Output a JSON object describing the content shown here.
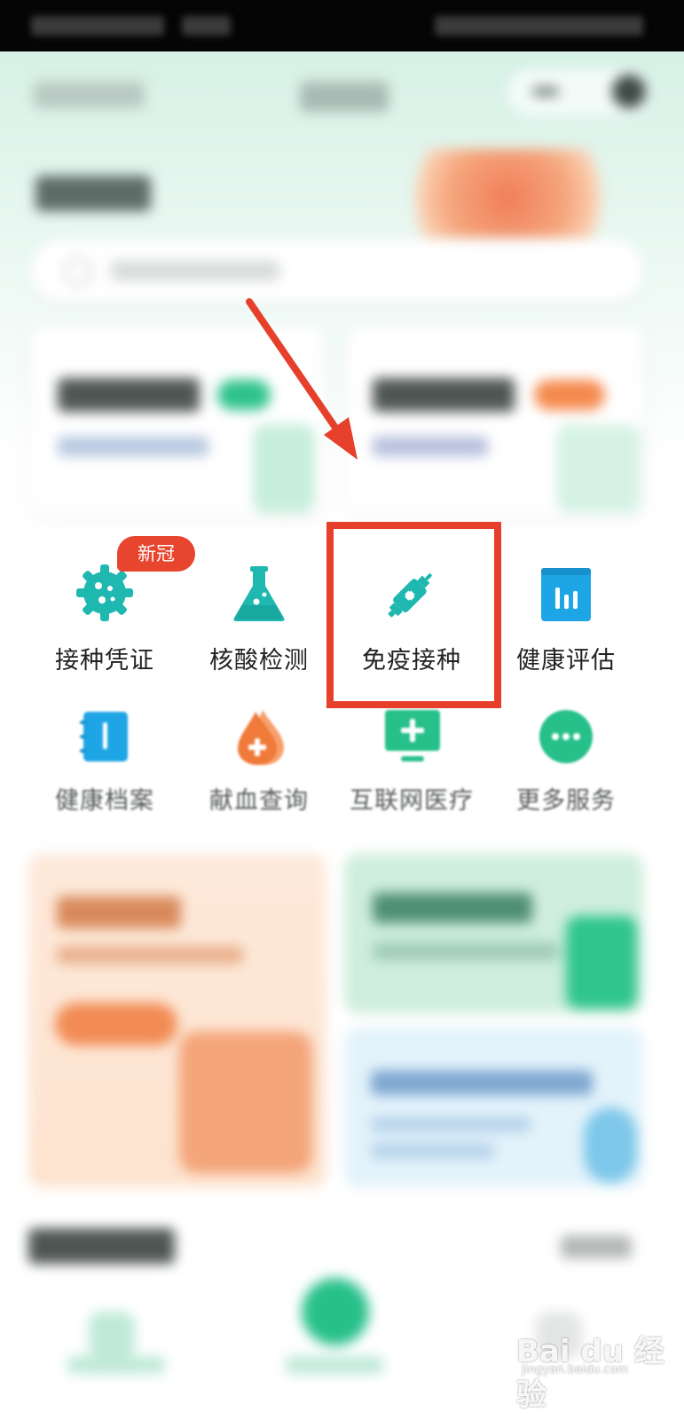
{
  "services_row1": [
    {
      "label": "接种凭证",
      "icon": "virus-gear-icon",
      "badge": "新冠"
    },
    {
      "label": "核酸检测",
      "icon": "flask-icon"
    },
    {
      "label": "免疫接种",
      "icon": "syringe-icon"
    },
    {
      "label": "健康评估",
      "icon": "chart-clipboard-icon"
    }
  ],
  "services_row2": [
    {
      "label": "健康档案",
      "icon": "notebook-icon"
    },
    {
      "label": "献血查询",
      "icon": "blood-drop-icon"
    },
    {
      "label": "互联网医疗",
      "icon": "monitor-plus-icon"
    },
    {
      "label": "更多服务",
      "icon": "more-dots-icon"
    }
  ],
  "watermark": {
    "brand": "Bai du 经验",
    "url": "jingyan.baidu.com"
  },
  "colors": {
    "accent_green": "#27c08a",
    "icon_teal": "#1fb8b0",
    "icon_blue": "#1ea5e6",
    "icon_orange": "#f07a3a",
    "badge_red": "#e8452f",
    "highlight_red": "#e6402d"
  }
}
